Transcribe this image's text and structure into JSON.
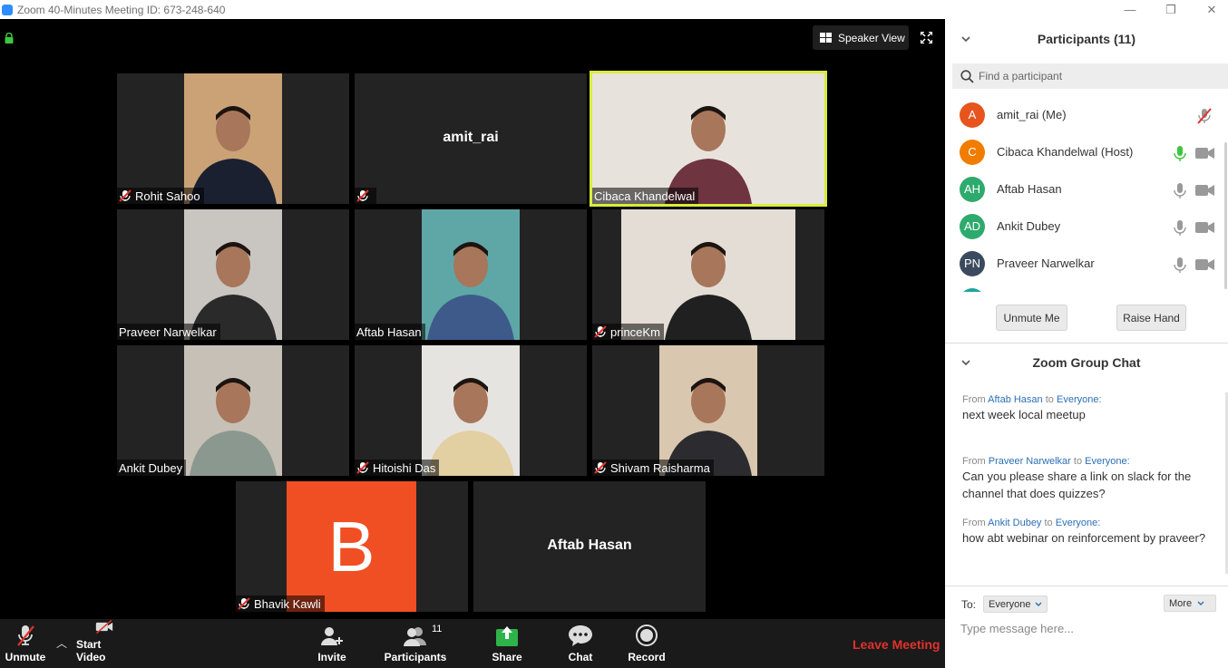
{
  "window": {
    "title": "Zoom 40-Minutes Meeting ID: 673-248-640",
    "minimize": "—",
    "maximize": "❐",
    "close": "✕"
  },
  "video": {
    "speaker_view_label": "Speaker View",
    "tiles": [
      {
        "name": "Rohit Sahoo",
        "muted": true,
        "has_video": true,
        "bg": "#caa276",
        "shirt": "#1b2030"
      },
      {
        "name": "amit_rai",
        "muted": true,
        "has_video": false
      },
      {
        "name": "Cibaca Khandelwal",
        "muted": false,
        "has_video": true,
        "active": true,
        "bg": "#e8e2dc",
        "shirt": "#6e3440"
      },
      {
        "name": "Praveer Narwelkar",
        "muted": false,
        "has_video": true,
        "bg": "#c9c6c2",
        "shirt": "#2a2a2a"
      },
      {
        "name": "Aftab Hasan",
        "muted": false,
        "has_video": true,
        "bg": "#5fa6a6",
        "shirt": "#3d5a8a"
      },
      {
        "name": "princeKm",
        "muted": true,
        "has_video": true,
        "bg": "#e4ddd6",
        "shirt": "#202020"
      },
      {
        "name": "Ankit Dubey",
        "muted": false,
        "has_video": true,
        "bg": "#c7c0b6",
        "shirt": "#8a9890"
      },
      {
        "name": "Hitoishi Das",
        "muted": true,
        "has_video": true,
        "bg": "#e6e4e0",
        "shirt": "#e2cfa2"
      },
      {
        "name": "Shivam Raisharma",
        "muted": true,
        "has_video": true,
        "bg": "#d9c7b0",
        "shirt": "#2c2c30"
      },
      {
        "name": "Bhavik Kawli",
        "muted": true,
        "has_video": false,
        "avatar_letter": "B"
      },
      {
        "name": "Aftab Hasan",
        "muted": false,
        "has_video": false
      }
    ]
  },
  "toolbar": {
    "unmute": "Unmute",
    "start_video": "Start Video",
    "invite": "Invite",
    "participants": "Participants",
    "participants_count": "11",
    "share": "Share",
    "chat": "Chat",
    "record": "Record",
    "leave": "Leave Meeting"
  },
  "participants_panel": {
    "title": "Participants (11)",
    "search_placeholder": "Find a participant",
    "list": [
      {
        "initials": "A",
        "name": "amit_rai (Me)",
        "color": "#e8541e"
      },
      {
        "initials": "C",
        "name": "Cibaca Khandelwal (Host)",
        "color": "#f07c00"
      },
      {
        "initials": "AH",
        "name": "Aftab Hasan",
        "color": "#2eaa6e"
      },
      {
        "initials": "AD",
        "name": "Ankit Dubey",
        "color": "#2eaa6e"
      },
      {
        "initials": "PN",
        "name": "Praveer Narwelkar",
        "color": "#3b4a5e"
      }
    ],
    "unmute_me": "Unmute Me",
    "raise_hand": "Raise Hand"
  },
  "chat_panel": {
    "title": "Zoom Group Chat",
    "from_label": "From",
    "to_label": "to",
    "messages": [
      {
        "from": "Aftab Hasan",
        "to": "Everyone:",
        "text": "next week local meetup"
      },
      {
        "from": "Praveer Narwelkar",
        "to": "Everyone:",
        "text": "Can you please share a link on slack for the channel that does quizzes?"
      },
      {
        "from": "Ankit Dubey",
        "to": "Everyone:",
        "text": "how abt webinar on reinforcement by praveer?"
      }
    ],
    "to_prefix": "To:",
    "recipient": "Everyone",
    "more": "More",
    "input_placeholder": "Type message here..."
  }
}
